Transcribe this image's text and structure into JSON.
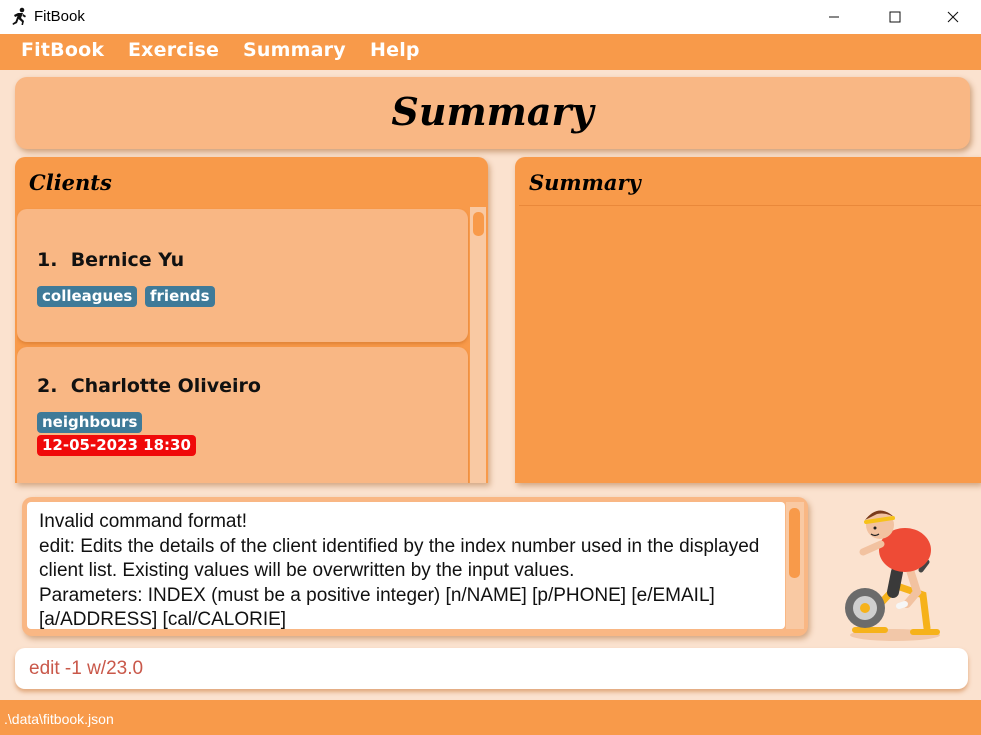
{
  "window": {
    "title": "FitBook",
    "icon": "running-person-icon",
    "controls": [
      "minimize-icon",
      "maximize-icon",
      "close-icon"
    ]
  },
  "menu": {
    "items": [
      {
        "label": "FitBook"
      },
      {
        "label": "Exercise"
      },
      {
        "label": "Summary"
      },
      {
        "label": "Help"
      }
    ]
  },
  "header": {
    "title": "Summary"
  },
  "clients": {
    "title": "Clients",
    "items": [
      {
        "index": "1.",
        "name": "Bernice Yu",
        "tags": [
          "colleagues",
          "friends"
        ],
        "appointment": ""
      },
      {
        "index": "2.",
        "name": "Charlotte Oliveiro",
        "tags": [
          "neighbours"
        ],
        "appointment": "12-05-2023 18:30"
      }
    ]
  },
  "summary": {
    "title": "Summary"
  },
  "result": {
    "lines": [
      "Invalid command format!",
      "edit: Edits the details of the client identified by the index number used in the displayed client list. Existing values will be overwritten by the input values.",
      "Parameters: INDEX (must be a positive integer) [n/NAME] [p/PHONE] [e/EMAIL] [a/ADDRESS] [cal/CALORIE]"
    ]
  },
  "mascot": {
    "icon": "exercise-bike-illustration"
  },
  "command": {
    "value": "edit -1 w/23.0"
  },
  "status": {
    "path": ".\\data\\fitbook.json"
  },
  "colors": {
    "accent": "#f89a4a",
    "panel_light": "#f9b784",
    "background": "#fbe2cf",
    "tag": "#3f7a98",
    "appointment_tag": "#f00a0a",
    "command_text": "#c9584a"
  }
}
